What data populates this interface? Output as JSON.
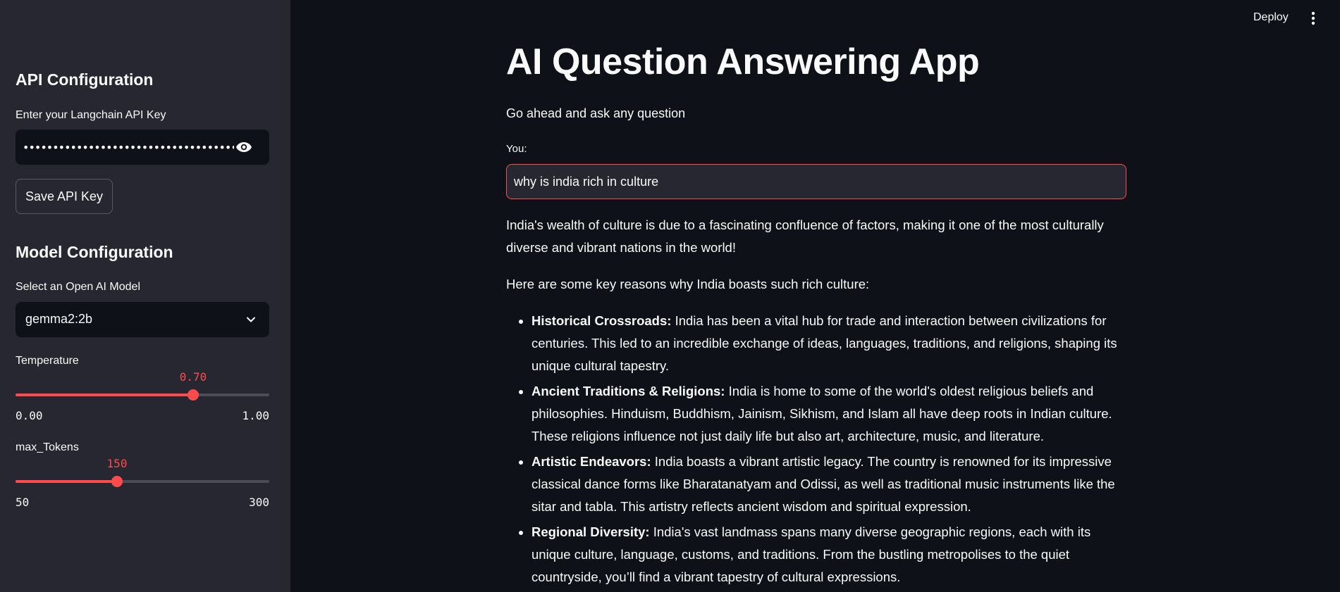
{
  "header": {
    "deploy_label": "Deploy",
    "menu_icon": "vertical-dots-icon"
  },
  "sidebar": {
    "api_heading": "API Configuration",
    "api_key_label": "Enter your Langchain API Key",
    "api_key_value": "••••••••••••••••••••••••••••••••••••••••••••",
    "api_key_toggle_icon": "eye-icon",
    "save_button_label": "Save API Key",
    "model_heading": "Model Configuration",
    "model_select_label": "Select an Open AI Model",
    "model_selected": "gemma2:2b",
    "temperature": {
      "label": "Temperature",
      "value_text": "0.70",
      "value": 0.7,
      "min_text": "0.00",
      "max_text": "1.00",
      "min": 0,
      "max": 1
    },
    "max_tokens": {
      "label": "max_Tokens",
      "value_text": "150",
      "value": 150,
      "min_text": "50",
      "max_text": "300",
      "min": 50,
      "max": 300
    }
  },
  "main": {
    "title": "AI Question Answering App",
    "subtitle": "Go ahead and ask any question",
    "input_label": "You:",
    "input_value": "why is india rich in culture",
    "answer_intro": "India's wealth of culture is due to a fascinating confluence of factors, making it one of the most culturally diverse and vibrant nations in the world!",
    "answer_lead": "Here are some key reasons why India boasts such rich culture:",
    "points": [
      {
        "title": "Historical Crossroads:",
        "text": " India has been a vital hub for trade and interaction between civilizations for centuries. This led to an incredible exchange of ideas, languages, traditions, and religions, shaping its unique cultural tapestry."
      },
      {
        "title": "Ancient Traditions & Religions:",
        "text": " India is home to some of the world's oldest religious beliefs and philosophies. Hinduism, Buddhism, Jainism, Sikhism, and Islam all have deep roots in Indian culture. These religions influence not just daily life but also art, architecture, music, and literature."
      },
      {
        "title": "Artistic Endeavors:",
        "text": " India boasts a vibrant artistic legacy. The country is renowned for its impressive classical dance forms like Bharatanatyam and Odissi, as well as traditional music instruments like the sitar and tabla. This artistry reflects ancient wisdom and spiritual expression."
      },
      {
        "title": "Regional Diversity:",
        "text": " India's vast landmass spans many diverse geographic regions, each with its unique culture, language, customs, and traditions. From the bustling metropolises to the quiet countryside, you’ll find a vibrant tapestry of cultural expressions."
      }
    ]
  },
  "colors": {
    "accent": "#ff4b4b",
    "background": "#0e1117",
    "sidebar": "#262730"
  }
}
